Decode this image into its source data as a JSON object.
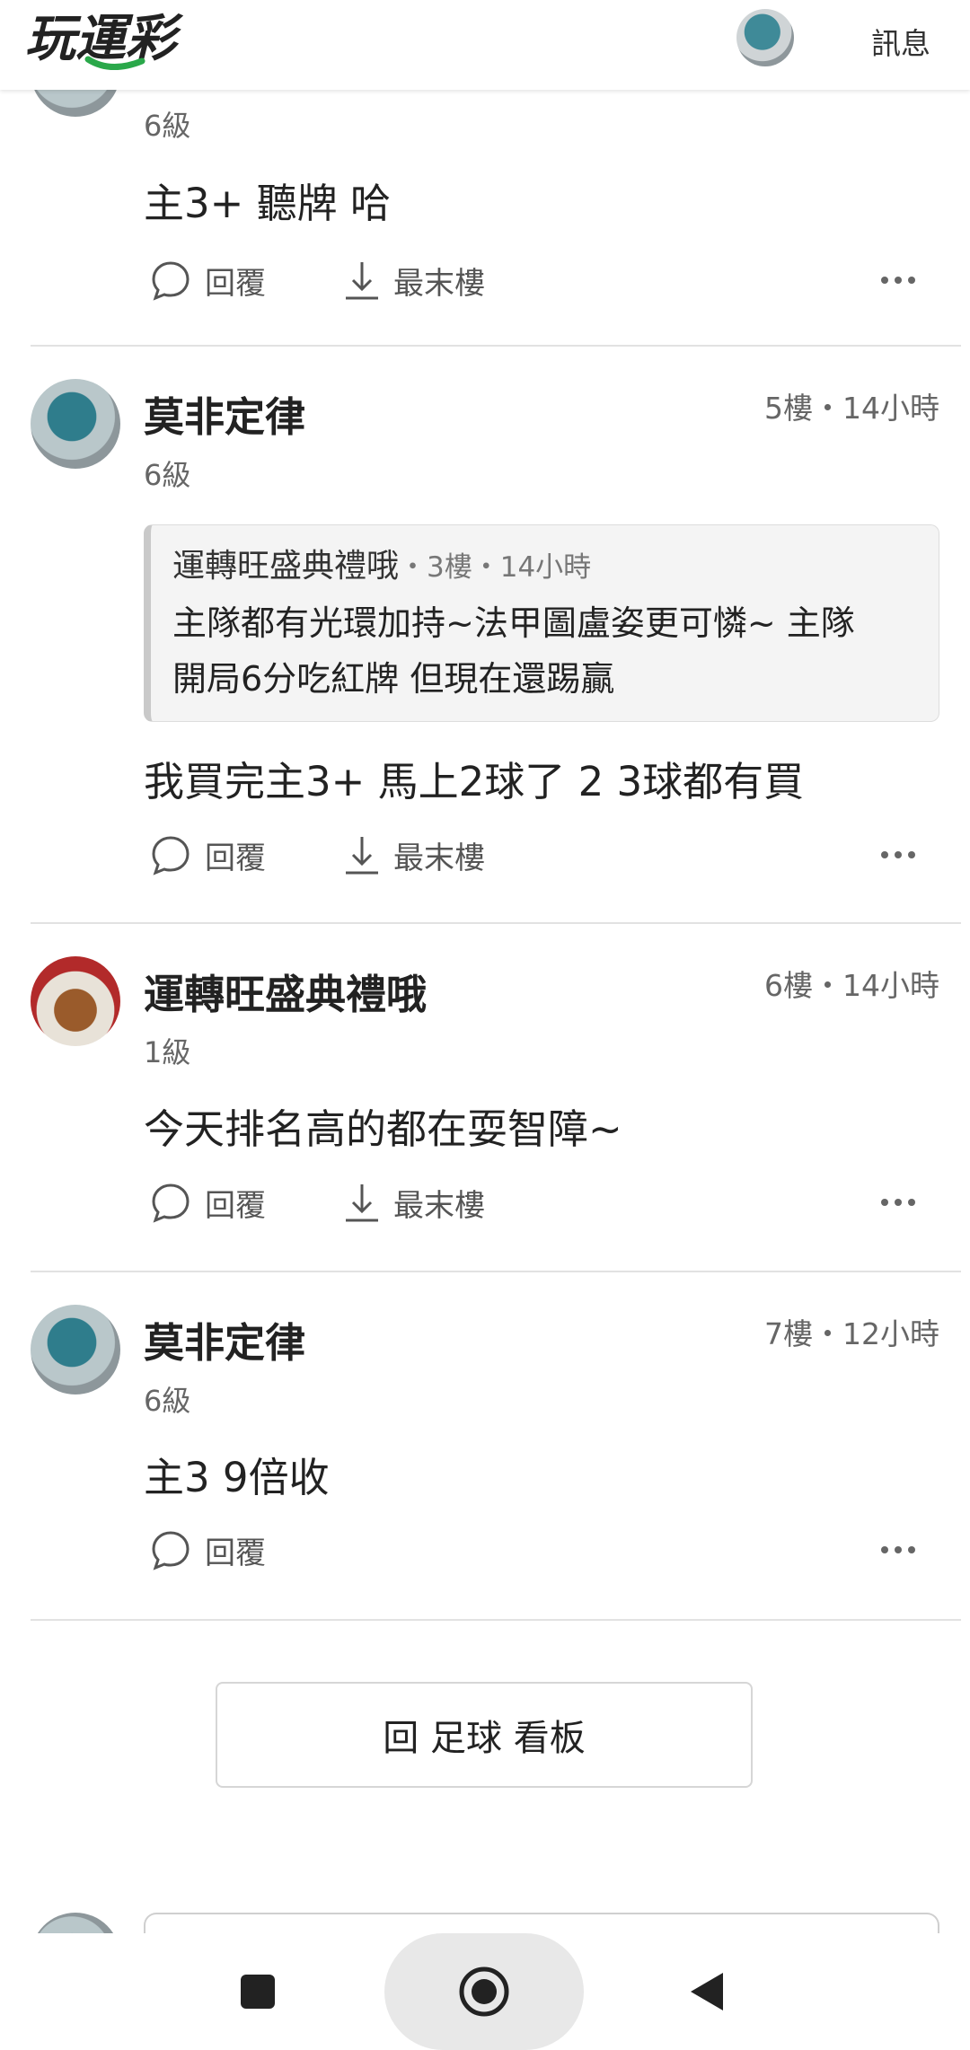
{
  "header": {
    "logo_text": "玩運彩",
    "messages_label": "訊息"
  },
  "posts": [
    {
      "level": "6級",
      "content": "主3+ 聽牌 哈"
    },
    {
      "username": "莫非定律",
      "meta": "5樓・14小時",
      "level": "6級",
      "quote": {
        "author": "運轉旺盛典禮哦",
        "meta": "・3樓・14小時",
        "line1": "主隊都有光環加持~法甲圖盧姿更可憐~ 主隊",
        "line2": "開局6分吃紅牌 但現在還踢贏"
      },
      "content": "我買完主3+ 馬上2球了 2 3球都有買"
    },
    {
      "username": "運轉旺盛典禮哦",
      "meta": "6樓・14小時",
      "level": "1級",
      "content": "今天排名高的都在耍智障~"
    },
    {
      "username": "莫非定律",
      "meta": "7樓・12小時",
      "level": "6級",
      "content": "主3 9倍收"
    }
  ],
  "actions": {
    "reply": "回覆",
    "last_floor": "最末樓"
  },
  "back_button": "回 足球 看板",
  "colors": {
    "logo_green": "#2aa84a",
    "text": "#222222",
    "muted": "#666666"
  }
}
